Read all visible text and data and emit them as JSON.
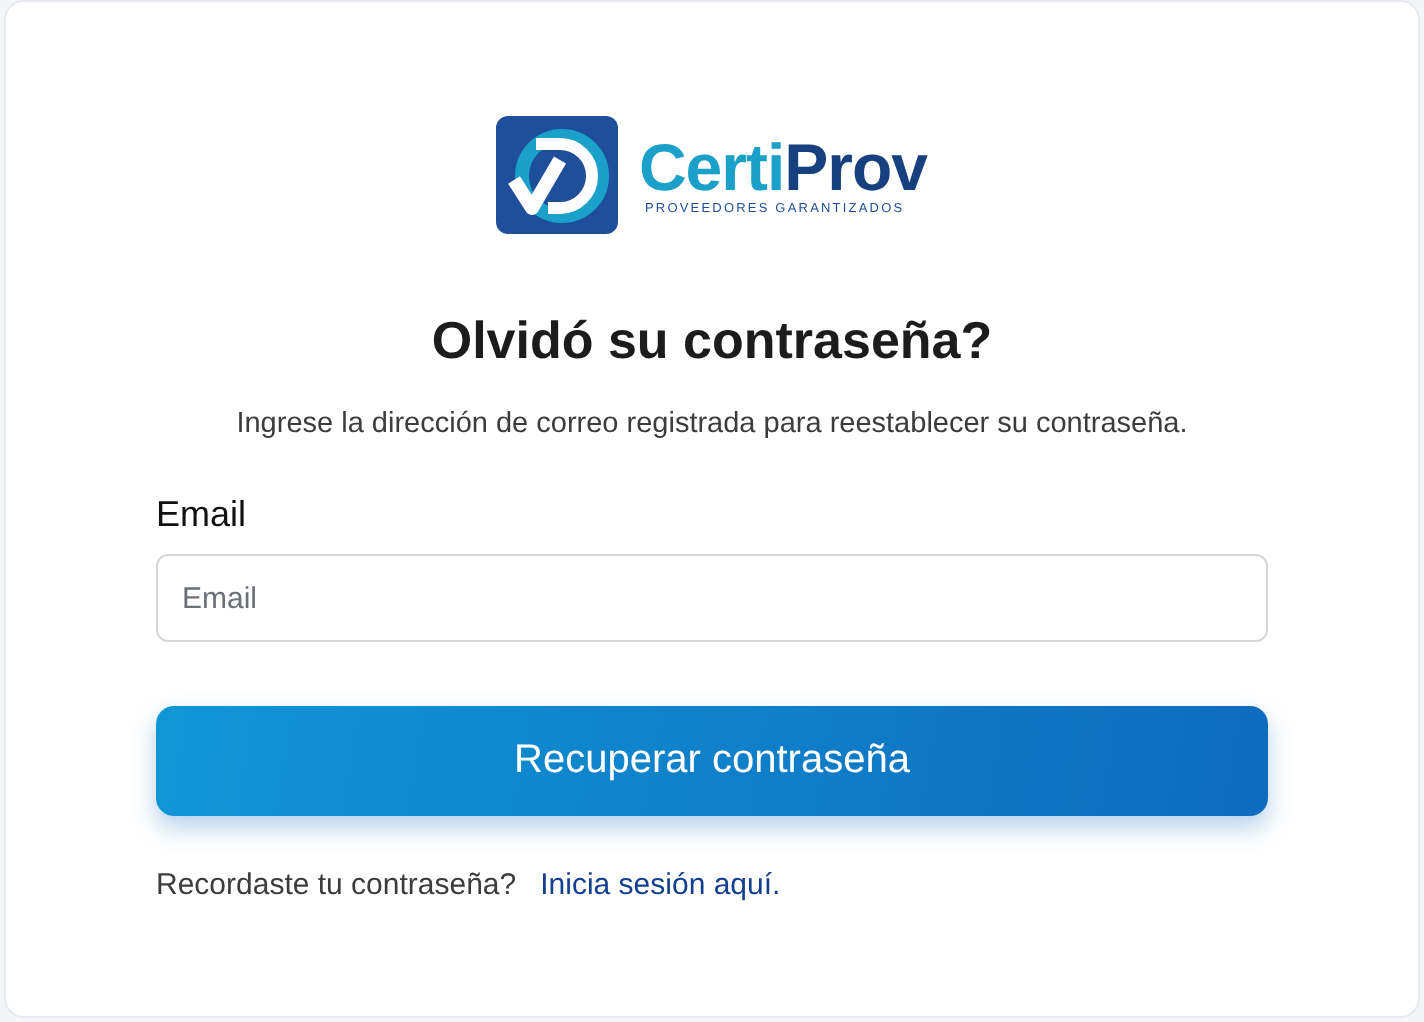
{
  "logo": {
    "brand_parts": [
      "Certi",
      "Prov"
    ],
    "tagline": "PROVEEDORES GARANTIZADOS"
  },
  "title": "Olvidó su contraseña?",
  "subtitle": "Ingrese la dirección de correo registrada para reestablecer su contraseña.",
  "email_field": {
    "label": "Email",
    "placeholder": "Email"
  },
  "submit_button": "Recuperar contraseña",
  "footer": {
    "text": "Recordaste tu contraseña?",
    "link": "Inicia sesión aquí."
  }
}
